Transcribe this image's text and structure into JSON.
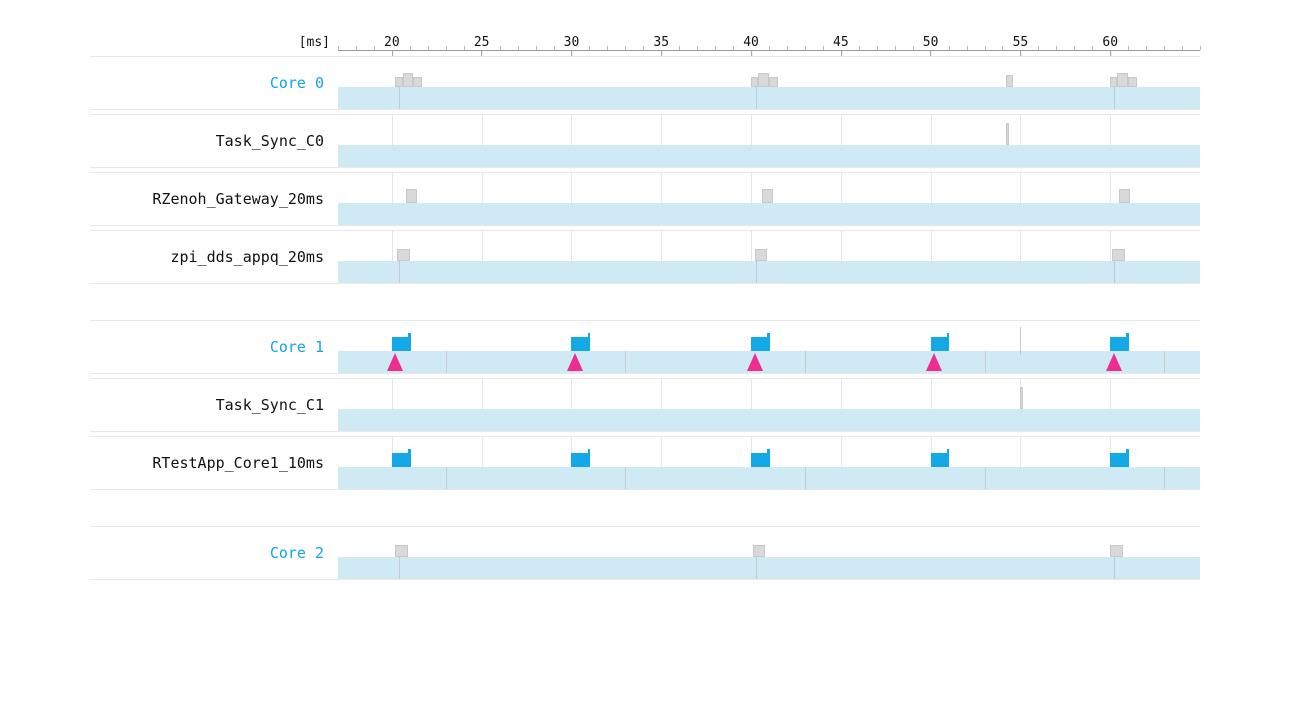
{
  "axis": {
    "unit": "[ms]",
    "min": 17.0,
    "max": 65.0,
    "ticks": [
      20,
      25,
      30,
      35,
      40,
      45,
      50,
      55,
      60
    ],
    "minor_step": 1
  },
  "colors": {
    "track": "#cfeaf5",
    "block_grey": "#d9d9d9",
    "block_blue": "#12a9e6",
    "accent": "#0ea5e9",
    "marker": "#ef2d91"
  },
  "chart_data": {
    "type": "timeline",
    "x_unit": "ms",
    "groups": [
      {
        "id": "core0",
        "rows": [
          {
            "id": "core0",
            "label": "Core 0",
            "is_core": true,
            "track": {
              "start": 17.0,
              "end": 65.0
            },
            "ticks_in_track": [
              20.4,
              40.3,
              60.2
            ],
            "blocks": [
              {
                "start": 20.2,
                "end": 20.6,
                "h": 10,
                "color": "grey"
              },
              {
                "start": 20.6,
                "end": 21.2,
                "h": 14,
                "color": "grey"
              },
              {
                "start": 21.2,
                "end": 21.7,
                "h": 10,
                "color": "grey"
              },
              {
                "start": 40.0,
                "end": 40.4,
                "h": 10,
                "color": "grey"
              },
              {
                "start": 40.4,
                "end": 41.0,
                "h": 14,
                "color": "grey"
              },
              {
                "start": 41.0,
                "end": 41.5,
                "h": 10,
                "color": "grey"
              },
              {
                "start": 54.2,
                "end": 54.6,
                "h": 12,
                "color": "grey"
              },
              {
                "start": 60.0,
                "end": 60.4,
                "h": 10,
                "color": "grey"
              },
              {
                "start": 60.4,
                "end": 61.0,
                "h": 14,
                "color": "grey"
              },
              {
                "start": 61.0,
                "end": 61.5,
                "h": 10,
                "color": "grey"
              }
            ]
          },
          {
            "id": "task_sync_c0",
            "label": "Task_Sync_C0",
            "track": {
              "start": 17.0,
              "end": 65.0
            },
            "gridlines": [
              20,
              25,
              30,
              35,
              40,
              45,
              50,
              55,
              60
            ],
            "blocks": [
              {
                "start": 54.2,
                "end": 54.35,
                "h": 22,
                "color": "grey"
              }
            ]
          },
          {
            "id": "rzenoh_gateway_20ms",
            "label": "RZenoh_Gateway_20ms",
            "track": {
              "start": 17.0,
              "end": 65.0
            },
            "gridlines": [
              20,
              25,
              30,
              35,
              40,
              45,
              50,
              55,
              60
            ],
            "blocks": [
              {
                "start": 20.8,
                "end": 21.4,
                "h": 14,
                "color": "grey"
              },
              {
                "start": 40.6,
                "end": 41.2,
                "h": 14,
                "color": "grey"
              },
              {
                "start": 60.5,
                "end": 61.1,
                "h": 14,
                "color": "grey"
              }
            ]
          },
          {
            "id": "zpi_dds_appq_20ms",
            "label": "zpi_dds_appq_20ms",
            "track": {
              "start": 17.0,
              "end": 65.0
            },
            "ticks_in_track": [
              20.4,
              40.3,
              60.2
            ],
            "gridlines": [
              20,
              25,
              30,
              35,
              40,
              45,
              50,
              55,
              60
            ],
            "blocks": [
              {
                "start": 20.3,
                "end": 21.0,
                "h": 12,
                "color": "grey"
              },
              {
                "start": 40.2,
                "end": 40.9,
                "h": 12,
                "color": "grey"
              },
              {
                "start": 60.1,
                "end": 60.8,
                "h": 12,
                "color": "grey"
              }
            ]
          }
        ]
      },
      {
        "id": "core1",
        "rows": [
          {
            "id": "core1",
            "label": "Core 1",
            "is_core": true,
            "track": {
              "start": 17.0,
              "end": 65.0
            },
            "ticks_in_track": [
              23.0,
              33.0,
              43.0,
              53.0,
              63.0
            ],
            "markers": [
              20.2,
              30.2,
              40.2,
              50.2,
              60.2
            ],
            "vlines": [
              {
                "at": 55.0
              }
            ],
            "blocks": [
              {
                "start": 20.0,
                "end": 20.9,
                "h": 14,
                "color": "blue"
              },
              {
                "start": 20.9,
                "end": 21.05,
                "h": 18,
                "color": "blue"
              },
              {
                "start": 30.0,
                "end": 30.9,
                "h": 14,
                "color": "blue"
              },
              {
                "start": 30.9,
                "end": 31.05,
                "h": 18,
                "color": "blue"
              },
              {
                "start": 40.0,
                "end": 40.9,
                "h": 14,
                "color": "blue"
              },
              {
                "start": 40.9,
                "end": 41.05,
                "h": 18,
                "color": "blue"
              },
              {
                "start": 50.0,
                "end": 50.9,
                "h": 14,
                "color": "blue"
              },
              {
                "start": 50.9,
                "end": 51.05,
                "h": 18,
                "color": "blue"
              },
              {
                "start": 60.0,
                "end": 60.9,
                "h": 14,
                "color": "blue"
              },
              {
                "start": 60.9,
                "end": 61.05,
                "h": 18,
                "color": "blue"
              }
            ]
          },
          {
            "id": "task_sync_c1",
            "label": "Task_Sync_C1",
            "track": {
              "start": 17.0,
              "end": 65.0
            },
            "gridlines": [
              20,
              25,
              30,
              35,
              40,
              45,
              50,
              55,
              60
            ],
            "blocks": [
              {
                "start": 55.0,
                "end": 55.15,
                "h": 22,
                "color": "grey"
              }
            ]
          },
          {
            "id": "rtestapp_core1_10ms",
            "label": "RTestApp_Core1_10ms",
            "track": {
              "start": 17.0,
              "end": 65.0
            },
            "ticks_in_track": [
              23.0,
              33.0,
              43.0,
              53.0,
              63.0
            ],
            "gridlines": [
              20,
              25,
              30,
              35,
              40,
              45,
              50,
              55,
              60
            ],
            "blocks": [
              {
                "start": 20.0,
                "end": 20.9,
                "h": 14,
                "color": "blue"
              },
              {
                "start": 20.9,
                "end": 21.05,
                "h": 18,
                "color": "blue"
              },
              {
                "start": 30.0,
                "end": 30.9,
                "h": 14,
                "color": "blue"
              },
              {
                "start": 30.9,
                "end": 31.05,
                "h": 18,
                "color": "blue"
              },
              {
                "start": 40.0,
                "end": 40.9,
                "h": 14,
                "color": "blue"
              },
              {
                "start": 40.9,
                "end": 41.05,
                "h": 18,
                "color": "blue"
              },
              {
                "start": 50.0,
                "end": 50.9,
                "h": 14,
                "color": "blue"
              },
              {
                "start": 50.9,
                "end": 51.05,
                "h": 18,
                "color": "blue"
              },
              {
                "start": 60.0,
                "end": 60.9,
                "h": 14,
                "color": "blue"
              },
              {
                "start": 60.9,
                "end": 61.05,
                "h": 18,
                "color": "blue"
              }
            ]
          }
        ]
      },
      {
        "id": "core2",
        "rows": [
          {
            "id": "core2",
            "label": "Core 2",
            "is_core": true,
            "track": {
              "start": 17.0,
              "end": 65.0
            },
            "ticks_in_track": [
              20.4,
              40.3,
              60.2
            ],
            "blocks": [
              {
                "start": 20.2,
                "end": 20.9,
                "h": 12,
                "color": "grey"
              },
              {
                "start": 40.1,
                "end": 40.8,
                "h": 12,
                "color": "grey"
              },
              {
                "start": 60.0,
                "end": 60.7,
                "h": 12,
                "color": "grey"
              }
            ]
          }
        ]
      }
    ]
  }
}
